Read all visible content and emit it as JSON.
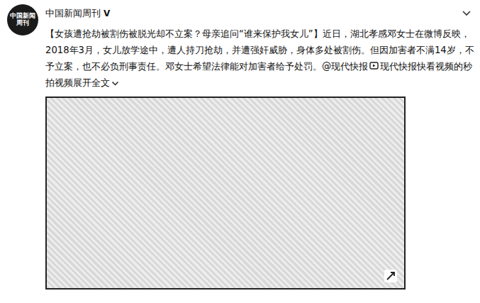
{
  "post": {
    "author": "中国新闻周刊",
    "verified_badge": "V",
    "avatar_text": "中国新闻周刊",
    "text": "【女孩遭抢劫被割伤被脱光却不立案？母亲追问“谁来保护我女儿”】近日，湖北孝感邓女士在微博反映，2018年3月，女儿放学途中，遭人持刀抢劫，并遭强奸威胁，身体多处被割伤。但因加害者不满14岁，不予立案，也不必负刑事责任。邓女士希望法律能对加害者给予处罚。",
    "mention": "@现代快报",
    "video_link": "现代快报快看视频的秒拍视频",
    "expand": "展开全文"
  },
  "video": {
    "kind": "video-frame"
  }
}
